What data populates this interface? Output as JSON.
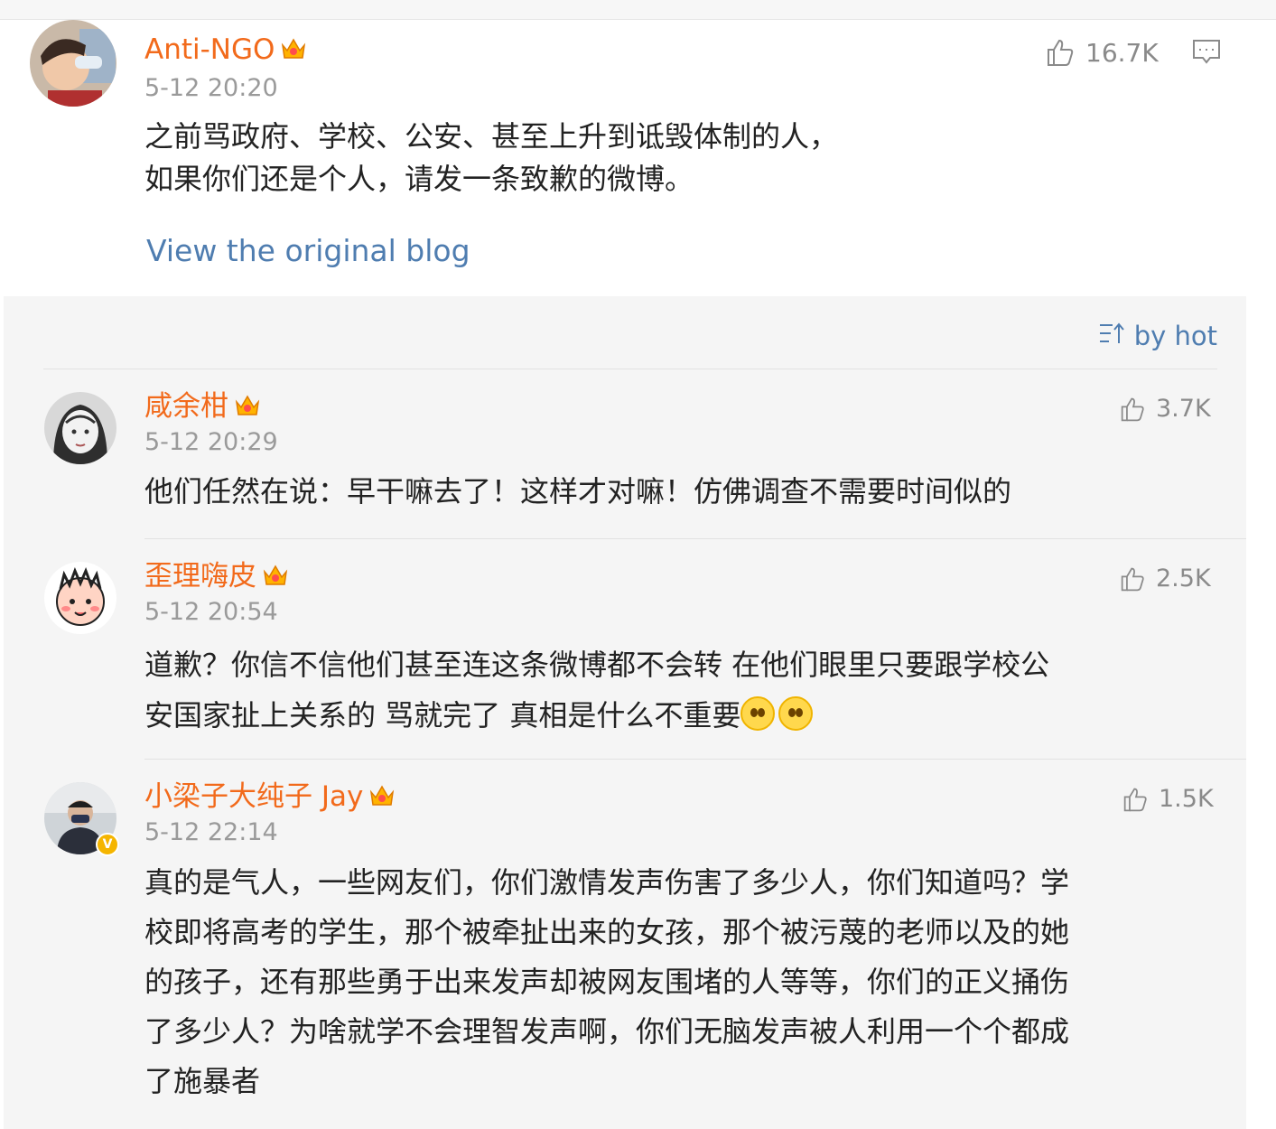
{
  "post": {
    "username": "Anti-NGO",
    "time": "5-12 20:20",
    "likes": "16.7K",
    "text_line1": "之前骂政府、学校、公安、甚至上升到诋毁体制的人，",
    "text_line2": "如果你们还是个人，请发一条致歉的微博。",
    "view_original": "View the original blog"
  },
  "sort_label": "by hot",
  "comments": [
    {
      "username": "咸余柑",
      "time": "5-12 20:29",
      "likes": "3.7K",
      "text": "他们任然在说：早干嘛去了！这样才对嘛！仿佛调查不需要时间似的"
    },
    {
      "username": "歪理嗨皮",
      "time": "5-12 20:54",
      "likes": "2.5K",
      "text_line1": "道歉？你信不信他们甚至连这条微博都不会转 在他们眼里只要跟学校公",
      "text_line2": "安国家扯上关系的 骂就完了 真相是什么不重要"
    },
    {
      "username": "小梁子大纯子 Jay",
      "time": "5-12 22:14",
      "likes": "1.5K",
      "lines": [
        "真的是气人，一些网友们，你们激情发声伤害了多少人，你们知道吗？学",
        "校即将高考的学生，那个被牵扯出来的女孩，那个被污蔑的老师以及的她",
        "的孩子，还有那些勇于出来发声却被网友围堵的人等等，你们的正义捅伤",
        "了多少人？为啥就学不会理智发声啊，你们无脑发声被人利用一个个都成",
        "了施暴者"
      ]
    }
  ],
  "colors": {
    "username": "#f26a1b",
    "link": "#4f7db0",
    "time": "#9a9a9a",
    "panel": "#f5f5f5"
  },
  "icons": [
    "thumbs-up-icon",
    "comment-icon",
    "sort-icon",
    "crown-badge-icon",
    "verified-badge-icon",
    "eye-roll-emoji"
  ]
}
